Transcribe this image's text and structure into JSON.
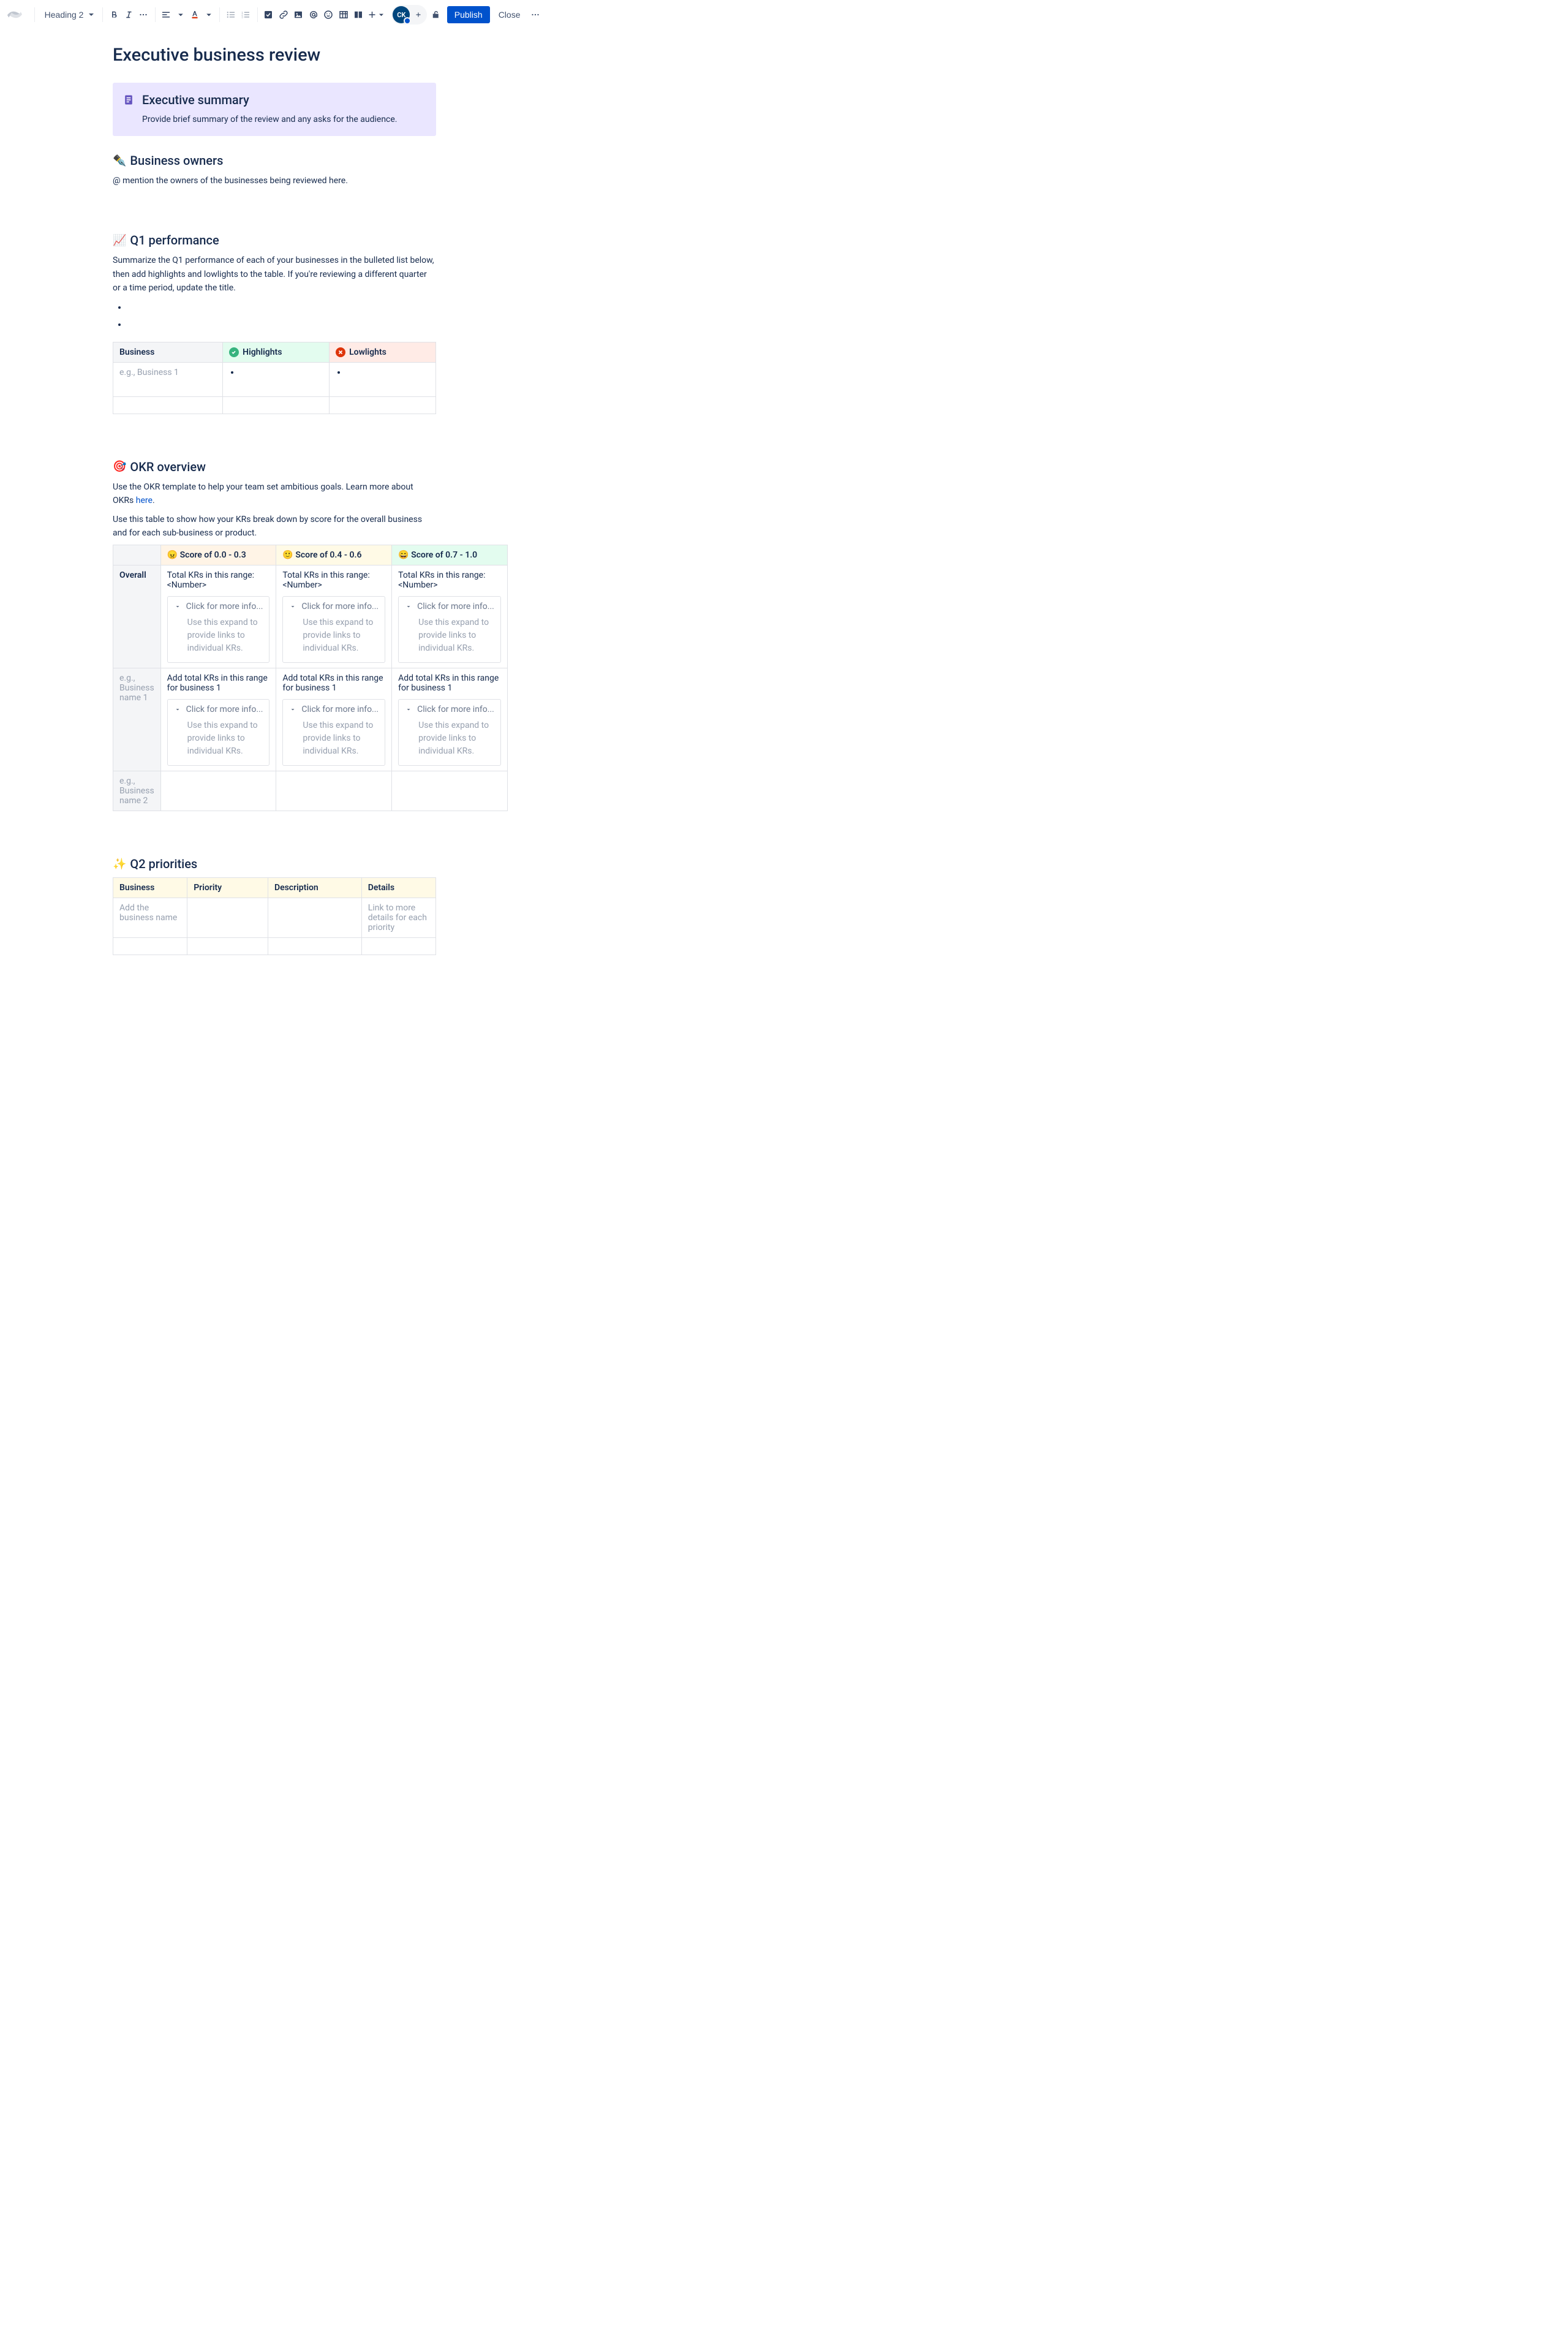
{
  "toolbar": {
    "heading_select": "Heading 2",
    "publish_label": "Publish",
    "close_label": "Close",
    "avatar_initials": "CK"
  },
  "page": {
    "title": "Executive business review"
  },
  "panel": {
    "title": "Executive summary",
    "body": "Provide brief summary of the review and any asks for the audience."
  },
  "owners": {
    "heading": "Business owners",
    "emoji": "✒️",
    "body": "@ mention the owners of the businesses being reviewed here."
  },
  "q1": {
    "heading": "Q1 performance",
    "emoji": "📈",
    "body": "Summarize the Q1 performance of each of your businesses in the bulleted list below, then add highlights and lowlights to the table. If you're reviewing a different quarter or a time period, update the title.",
    "table": {
      "headers": [
        "Business",
        "Highlights",
        "Lowlights"
      ],
      "row1_business": "e.g., Business 1"
    }
  },
  "okr": {
    "heading": "OKR overview",
    "emoji": "🎯",
    "body1_pre": "Use the OKR template to help your team set ambitious goals. Learn more about OKRs ",
    "body1_link": "here",
    "body1_post": ".",
    "body2": "Use this table to show how your KRs break down by score for the overall business and for each sub-business or product.",
    "scores": {
      "low": {
        "emoji": "😠",
        "label": "Score of 0.0 - 0.3"
      },
      "mid": {
        "emoji": "🙂",
        "label": "Score of 0.4 - 0.6"
      },
      "high": {
        "emoji": "😄",
        "label": "Score of 0.7 - 1.0"
      }
    },
    "overall_label": "Overall",
    "total_krs": "Total KRs in this range: <Number>",
    "expand_title": "Click for more info...",
    "expand_body": "Use this expand to provide links to individual KRs.",
    "biz1_label": "e.g., Business name 1",
    "biz1_text": "Add total KRs in this range for business 1",
    "biz2_label": "e.g., Business name 2"
  },
  "q2": {
    "heading": "Q2 priorities",
    "emoji": "✨",
    "headers": [
      "Business",
      "Priority",
      "Description",
      "Details"
    ],
    "row1_business": "Add the business name",
    "row1_details": "Link to more details for each priority"
  }
}
